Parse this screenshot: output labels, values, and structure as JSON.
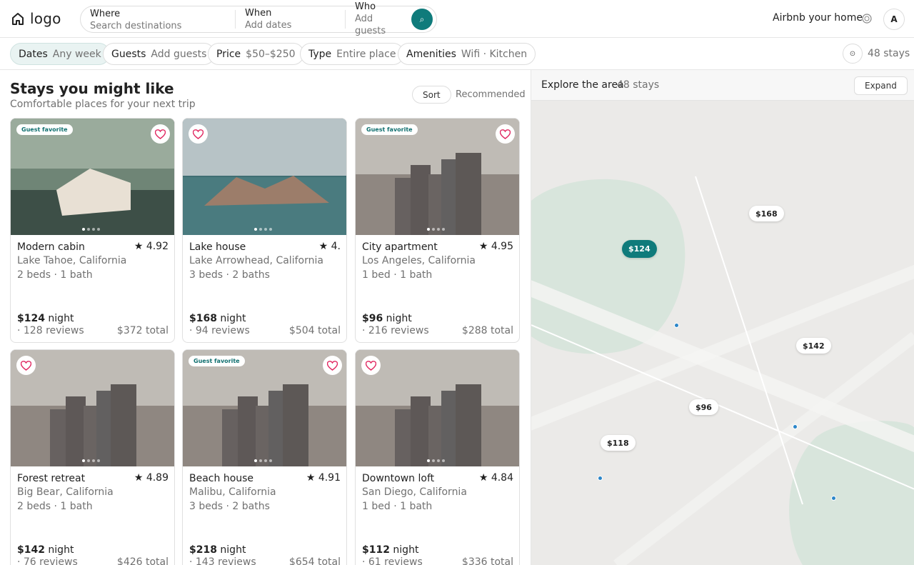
{
  "header": {
    "logo_text": "logo",
    "search": {
      "where_label": "Where",
      "where_placeholder": "Search destinations",
      "when_label": "When",
      "when_value": "Add dates",
      "who_label": "Who",
      "who_value": "Add guests",
      "button_glyph": "⌕"
    },
    "host_link": "Airbnb your home",
    "avatar_initial": "A",
    "icons": {
      "logo": "home-icon",
      "search": "search-icon",
      "globe": "globe-icon"
    }
  },
  "filters": {
    "chips": [
      {
        "key": "Dates",
        "value": "Any week",
        "active": true
      },
      {
        "key": "Guests",
        "value": "Add guests",
        "active": false
      },
      {
        "key": "Price",
        "value": "$50–$250",
        "active": false
      },
      {
        "key": "Type",
        "value": "Entire place",
        "active": false
      },
      {
        "key": "Amenities",
        "value": "Wifi · Kitchen",
        "active": false
      }
    ],
    "toggle_glyph": "⊙",
    "count": "48 stays"
  },
  "listings": {
    "title": "Stays you might like",
    "subtitle": "Comfortable places for your next trip",
    "sort_label": "Sort",
    "sort_value": "Recommended",
    "items": [
      {
        "badge": "Guest favorite",
        "title": "Modern cabin",
        "rating": "★ 4.92",
        "location": "Lake Tahoe, California",
        "beds": "2 beds · 1 bath",
        "price": "$124",
        "price_unit": " night",
        "reviews": "· 128 reviews",
        "total": "$372 total",
        "image": "cabin"
      },
      {
        "badge": "",
        "title": "Lake house",
        "rating": "★ 4.",
        "location": "Lake Arrowhead, California",
        "beds": "3 beds · 2 baths",
        "price": "$168",
        "price_unit": " night",
        "reviews": "· 94 reviews",
        "total": "$504 total",
        "image": "lake"
      },
      {
        "badge": "Guest favorite",
        "title": "City apartment",
        "rating": "★ 4.95",
        "location": "Los Angeles, California",
        "beds": "1 bed · 1 bath",
        "price": "$96",
        "price_unit": " night",
        "reviews": "· 216 reviews",
        "total": "$288 total",
        "image": "city"
      },
      {
        "badge": "",
        "title": "Forest retreat",
        "rating": "★ 4.89",
        "location": "Big Bear, California",
        "beds": "2 beds · 1 bath",
        "price": "$142",
        "price_unit": " night",
        "reviews": "· 76 reviews",
        "total": "$426 total",
        "image": "city"
      },
      {
        "badge": "Guest favorite",
        "title": "Beach house",
        "rating": "★ 4.91",
        "location": "Malibu, California",
        "beds": "3 beds · 2 baths",
        "price": "$218",
        "price_unit": " night",
        "reviews": "· 143 reviews",
        "total": "$654 total",
        "image": "city"
      },
      {
        "badge": "",
        "title": "Downtown loft",
        "rating": "★ 4.84",
        "location": "San Diego, California",
        "beds": "1 bed · 1 bath",
        "price": "$112",
        "price_unit": " night",
        "reviews": "· 61 reviews",
        "total": "$336 total",
        "image": "city"
      }
    ]
  },
  "map": {
    "title": "Explore the area",
    "count": "48 stays",
    "expand_label": "Expand",
    "pins": [
      {
        "label": "$168",
        "selected": false
      },
      {
        "label": "$124",
        "selected": true
      },
      {
        "label": "$142",
        "selected": false
      },
      {
        "label": "$96",
        "selected": false
      },
      {
        "label": "$118",
        "selected": false
      }
    ],
    "colors": {
      "accent": "#0f7b7b",
      "land": "#ebeae8",
      "park": "#d7e5dc"
    }
  }
}
